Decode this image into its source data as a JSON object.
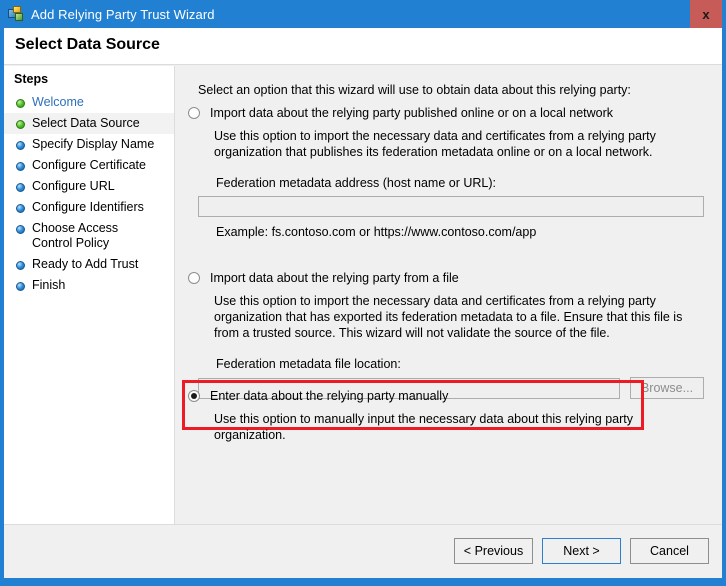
{
  "window": {
    "title": "Add Relying Party Trust Wizard",
    "icon": "wizard-icon",
    "close_label": "x",
    "accent_color": "#2180d2",
    "close_color": "#c75b57"
  },
  "header": {
    "page_title": "Select Data Source"
  },
  "sidebar": {
    "heading": "Steps",
    "items": [
      {
        "label": "Welcome",
        "bullet": "green",
        "style": "link",
        "highlight": false
      },
      {
        "label": "Select Data Source",
        "bullet": "green",
        "style": "normal",
        "highlight": true
      },
      {
        "label": "Specify Display Name",
        "bullet": "blue",
        "style": "normal",
        "highlight": false
      },
      {
        "label": "Configure Certificate",
        "bullet": "blue",
        "style": "normal",
        "highlight": false
      },
      {
        "label": "Configure URL",
        "bullet": "blue",
        "style": "normal",
        "highlight": false
      },
      {
        "label": "Configure Identifiers",
        "bullet": "blue",
        "style": "normal",
        "highlight": false
      },
      {
        "label": "Choose Access Control Policy",
        "bullet": "blue",
        "style": "normal",
        "highlight": false
      },
      {
        "label": "Ready to Add Trust",
        "bullet": "blue",
        "style": "normal",
        "highlight": false
      },
      {
        "label": "Finish",
        "bullet": "blue",
        "style": "normal",
        "highlight": false
      }
    ]
  },
  "main": {
    "intro": "Select an option that this wizard will use to obtain data about this relying party:",
    "option_online": {
      "label": "Import data about the relying party published online or on a local network",
      "selected": false,
      "description": "Use this option to import the necessary data and certificates from a relying party organization that publishes its federation metadata online or on a local network.",
      "field_label": "Federation metadata address (host name or URL):",
      "field_value": "",
      "example": "Example: fs.contoso.com or https://www.contoso.com/app"
    },
    "option_file": {
      "label": "Import data about the relying party from a file",
      "selected": false,
      "description": "Use this option to import the necessary data and certificates from a relying party organization that has exported its federation metadata to a file. Ensure that this file is from a trusted source.  This wizard will not validate the source of the file.",
      "field_label": "Federation metadata file location:",
      "field_value": "",
      "browse_label": "Browse..."
    },
    "option_manual": {
      "label": "Enter data about the relying party manually",
      "selected": true,
      "description": "Use this option to manually input the necessary data about this relying party organization.",
      "highlight_color": "#ed1c24"
    }
  },
  "footer": {
    "previous_label": "< Previous",
    "next_label": "Next >",
    "cancel_label": "Cancel"
  }
}
